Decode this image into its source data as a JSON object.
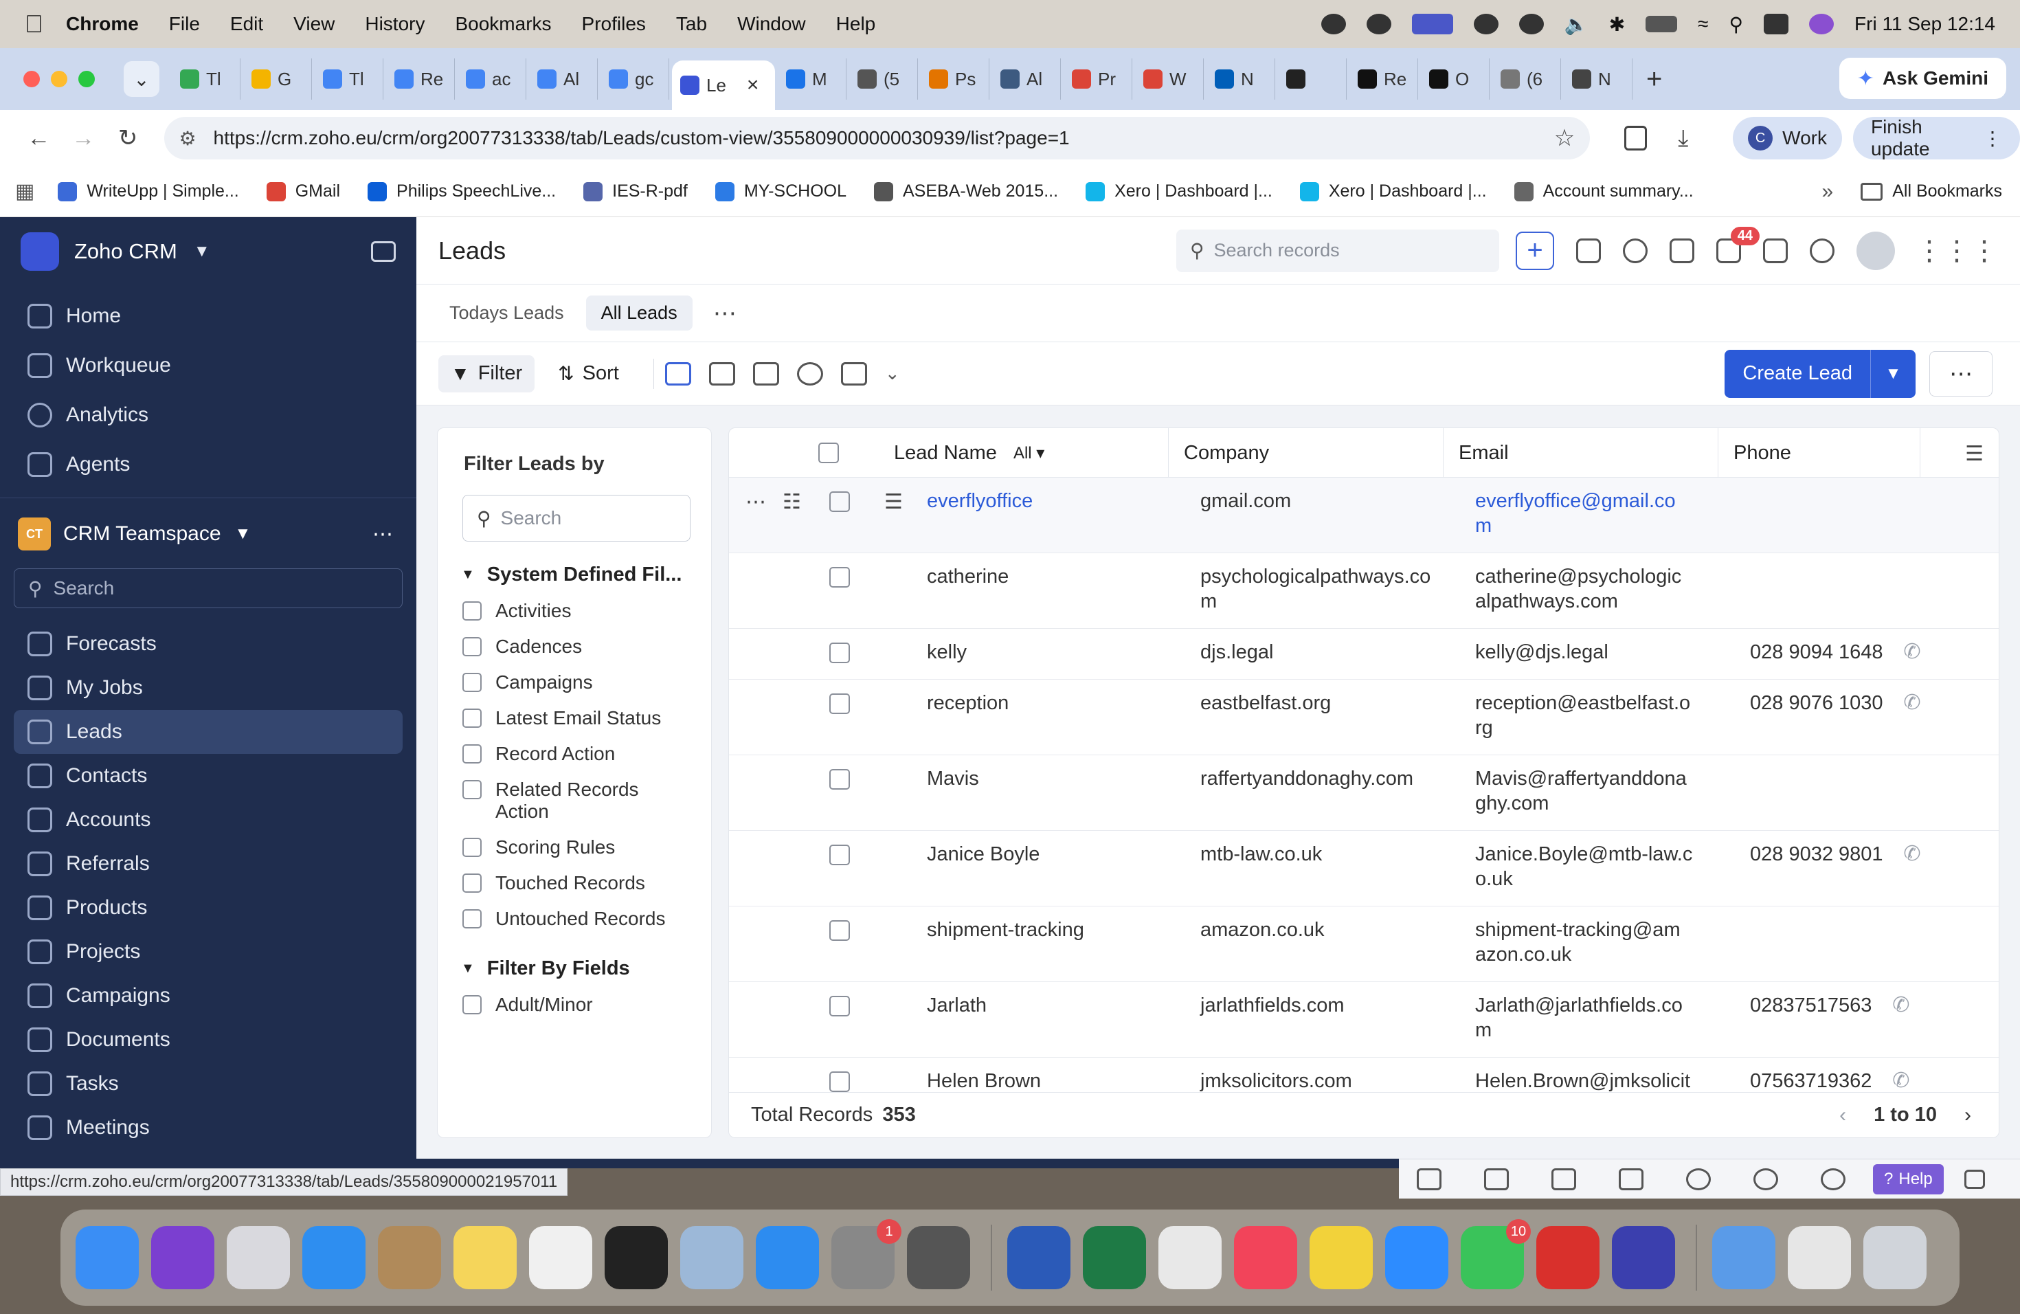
{
  "menubar": {
    "app": "Chrome",
    "items": [
      "File",
      "Edit",
      "View",
      "History",
      "Bookmarks",
      "Profiles",
      "Tab",
      "Window",
      "Help"
    ],
    "datetime": "Fri 11 Sep  12:14"
  },
  "tabs": [
    {
      "label": "Tl",
      "color": "#34a853"
    },
    {
      "label": "G",
      "color": "#f4b400"
    },
    {
      "label": "Tl",
      "color": "#4285f4"
    },
    {
      "label": "Re",
      "color": "#4285f4"
    },
    {
      "label": "ac",
      "color": "#4285f4"
    },
    {
      "label": "Al",
      "color": "#4285f4"
    },
    {
      "label": "gc",
      "color": "#4285f4"
    },
    {
      "label": "Le",
      "color": "#3b54d6",
      "active": true
    },
    {
      "label": "M",
      "color": "#1a73e8"
    },
    {
      "label": "(5",
      "color": "#555555"
    },
    {
      "label": "Ps",
      "color": "#e37400"
    },
    {
      "label": "Al",
      "color": "#3d5a80"
    },
    {
      "label": "Pr",
      "color": "#db4437"
    },
    {
      "label": "W",
      "color": "#db4437"
    },
    {
      "label": "N",
      "color": "#005eb8"
    },
    {
      "label": "",
      "color": "#222222"
    },
    {
      "label": "Re",
      "color": "#111111"
    },
    {
      "label": "O",
      "color": "#111111"
    },
    {
      "label": "(6",
      "color": "#777777"
    },
    {
      "label": "N",
      "color": "#444444"
    }
  ],
  "gemini_label": "Ask Gemini",
  "address": "https://crm.zoho.eu/crm/org20077313338/tab/Leads/custom-view/355809000000030939/list?page=1",
  "profile": {
    "initial": "C",
    "label": "Work"
  },
  "finish_update": "Finish update",
  "bookmarks": [
    {
      "label": "WriteUpp | Simple...",
      "color": "#3b6ad8"
    },
    {
      "label": "GMail",
      "color": "#db4437"
    },
    {
      "label": "Philips SpeechLive...",
      "color": "#0b5ed7"
    },
    {
      "label": "IES-R-pdf",
      "color": "#5566aa"
    },
    {
      "label": "MY-SCHOOL",
      "color": "#2c7be5"
    },
    {
      "label": "ASEBA-Web 2015...",
      "color": "#555555"
    },
    {
      "label": "Xero | Dashboard |...",
      "color": "#13b5ea"
    },
    {
      "label": "Xero | Dashboard |...",
      "color": "#13b5ea"
    },
    {
      "label": "Account summary...",
      "color": "#666666"
    }
  ],
  "all_bookmarks": "All Bookmarks",
  "sidebar": {
    "brand": "Zoho CRM",
    "top_items": [
      "Home",
      "Workqueue",
      "Analytics",
      "Agents"
    ],
    "teamspace": {
      "badge": "CT",
      "label": "CRM Teamspace"
    },
    "search_placeholder": "Search",
    "modules": [
      "Forecasts",
      "My Jobs",
      "Leads",
      "Contacts",
      "Accounts",
      "Referrals",
      "Products",
      "Projects",
      "Campaigns",
      "Documents",
      "Tasks",
      "Meetings"
    ],
    "active": "Leads"
  },
  "header": {
    "title": "Leads",
    "search_placeholder": "Search records",
    "mail_badge": "44"
  },
  "view_tabs": [
    "Todays Leads",
    "All Leads"
  ],
  "actions": {
    "filter": "Filter",
    "sort": "Sort",
    "create": "Create Lead"
  },
  "filter_panel": {
    "title": "Filter Leads by",
    "search_placeholder": "Search",
    "group1": "System Defined Fil...",
    "options1": [
      "Activities",
      "Cadences",
      "Campaigns",
      "Latest Email Status",
      "Record Action",
      "Related Records Action",
      "Scoring Rules",
      "Touched Records",
      "Untouched Records"
    ],
    "group2": "Filter By Fields",
    "options2": [
      "Adult/Minor"
    ]
  },
  "table": {
    "columns": {
      "name": "Lead Name",
      "filter": "All",
      "company": "Company",
      "email": "Email",
      "phone": "Phone"
    },
    "rows": [
      {
        "name": "everflyoffice",
        "company": "gmail.com",
        "email1": "everflyoffice@gmail.co",
        "email2": "m",
        "phone": ""
      },
      {
        "name": "catherine",
        "company": "psychologicalpathways.co",
        "company2": "m",
        "email1": "catherine@psychologic",
        "email2": "alpathways.com",
        "phone": ""
      },
      {
        "name": "kelly",
        "company": "djs.legal",
        "email1": "kelly@djs.legal",
        "email2": "",
        "phone": "028 9094 1648"
      },
      {
        "name": "reception",
        "company": "eastbelfast.org",
        "email1": "reception@eastbelfast.o",
        "email2": "rg",
        "phone": "028 9076 1030"
      },
      {
        "name": "Mavis",
        "company": "raffertyanddonaghy.com",
        "email1": "Mavis@raffertyanddona",
        "email2": "ghy.com",
        "phone": ""
      },
      {
        "name": "Janice Boyle",
        "company": "mtb-law.co.uk",
        "email1": "Janice.Boyle@mtb-law.c",
        "email2": "o.uk",
        "phone": "028 9032 9801"
      },
      {
        "name": "shipment-tracking",
        "company": "amazon.co.uk",
        "email1": "shipment-tracking@am",
        "email2": "azon.co.uk",
        "phone": ""
      },
      {
        "name": "Jarlath",
        "company": "jarlathfields.com",
        "email1": "Jarlath@jarlathfields.co",
        "email2": "m",
        "phone": "02837517563"
      },
      {
        "name": "Helen Brown",
        "company": "jmksolicitors.com",
        "email1": "Helen.Brown@jmksolicit",
        "email2": "",
        "phone": "07563719362"
      }
    ],
    "total_label": "Total Records",
    "total": "353",
    "range": "1 to 10"
  },
  "status_url": "https://crm.zoho.eu/crm/org20077313338/tab/Leads/355809000021957011",
  "help_label": "Help",
  "dock": [
    {
      "name": "finder",
      "color": "#3a8ef5"
    },
    {
      "name": "siri",
      "color": "#7b3fd0"
    },
    {
      "name": "launchpad",
      "color": "#d9d9de"
    },
    {
      "name": "safari",
      "color": "#2e8ef0"
    },
    {
      "name": "contacts",
      "color": "#b08a5a"
    },
    {
      "name": "notes",
      "color": "#f5d55a"
    },
    {
      "name": "freeform",
      "color": "#f0f0f0"
    },
    {
      "name": "app-black",
      "color": "#222222"
    },
    {
      "name": "preview",
      "color": "#9cb8d8"
    },
    {
      "name": "app-store",
      "color": "#2d8cf0"
    },
    {
      "name": "system-settings",
      "color": "#888888",
      "badge": "1"
    },
    {
      "name": "iphone-mirroring",
      "color": "#555555"
    },
    {
      "name": "word",
      "color": "#2b5ab8"
    },
    {
      "name": "excel",
      "color": "#1e7a45"
    },
    {
      "name": "chrome",
      "color": "#e8e8e8"
    },
    {
      "name": "music",
      "color": "#f2445a"
    },
    {
      "name": "app-yellow",
      "color": "#f2d23a"
    },
    {
      "name": "zoom",
      "color": "#2d8cff"
    },
    {
      "name": "facetime",
      "color": "#3ac35a",
      "badge": "10"
    },
    {
      "name": "acrobat",
      "color": "#d9302c"
    },
    {
      "name": "grammarly",
      "color": "#3b3fae"
    },
    {
      "name": "downloads",
      "color": "#5a9be8"
    },
    {
      "name": "docs-stack",
      "color": "#e6e6e6"
    },
    {
      "name": "trash",
      "color": "#d0d4da"
    }
  ]
}
